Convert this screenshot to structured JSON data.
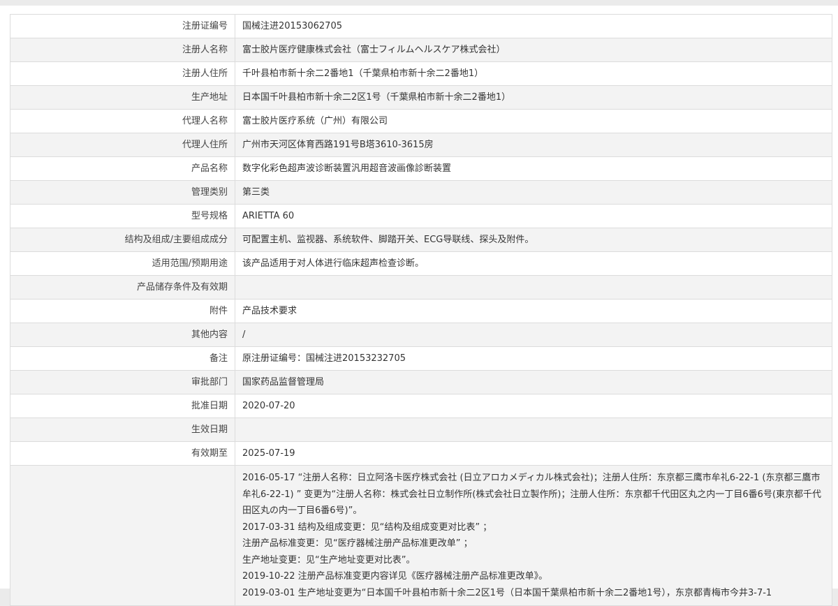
{
  "rows": [
    {
      "label": "注册证编号",
      "value": "国械注进20153062705"
    },
    {
      "label": "注册人名称",
      "value": "富士胶片医疗健康株式会社（富士フィルムヘルスケア株式会社）"
    },
    {
      "label": "注册人住所",
      "value": "千叶县柏市新十余二2番地1（千葉県柏市新十余二2番地1）"
    },
    {
      "label": "生产地址",
      "value": "日本国千叶县柏市新十余二2区1号（千葉県柏市新十余二2番地1）"
    },
    {
      "label": "代理人名称",
      "value": "富士胶片医疗系统（广州）有限公司"
    },
    {
      "label": "代理人住所",
      "value": "广州市天河区体育西路191号B塔3610-3615房"
    },
    {
      "label": "产品名称",
      "value": "数字化彩色超声波诊断装置汎用超音波画像診断装置"
    },
    {
      "label": "管理类别",
      "value": "第三类"
    },
    {
      "label": "型号规格",
      "value": "ARIETTA 60"
    },
    {
      "label": "结构及组成/主要组成成分",
      "value": "可配置主机、监视器、系统软件、脚踏开关、ECG导联线、探头及附件。"
    },
    {
      "label": "适用范围/预期用途",
      "value": "该产品适用于对人体进行临床超声检查诊断。"
    },
    {
      "label": "产品储存条件及有效期",
      "value": ""
    },
    {
      "label": "附件",
      "value": "产品技术要求"
    },
    {
      "label": "其他内容",
      "value": "/"
    },
    {
      "label": "备注",
      "value": "原注册证编号：国械注进20153232705"
    },
    {
      "label": "审批部门",
      "value": "国家药品监督管理局"
    },
    {
      "label": "批准日期",
      "value": "2020-07-20"
    },
    {
      "label": "生效日期",
      "value": ""
    },
    {
      "label": "有效期至",
      "value": "2025-07-19"
    }
  ],
  "change_history": {
    "label": "",
    "lines": [
      "2016-05-17 “注册人名称：日立阿洛卡医疗株式会社 (日立アロカメディカル株式会社)；注册人住所：东京都三鹰市牟礼6-22-1 (东京都三鷹市牟礼6-22-1) ” 变更为“注册人名称：株式会社日立制作所(株式会社日立製作所)；注册人住所：东京都千代田区丸之内一丁目6番6号(東京都千代田区丸の内一丁目6番6号)”。",
      "2017-03-31 结构及组成变更：见“结构及组成变更对比表” ；",
      "注册产品标准变更：见“医疗器械注册产品标准更改单” ；",
      "生产地址变更：见“生产地址变更对比表”。",
      "2019-10-22 注册产品标准变更内容详见《医疗器械注册产品标准更改单》。",
      "2019-03-01 生产地址变更为“日本国千叶县柏市新十余二2区1号（日本国千葉県柏市新十余二2番地1号），东京都青梅市今井3-7-1"
    ]
  }
}
